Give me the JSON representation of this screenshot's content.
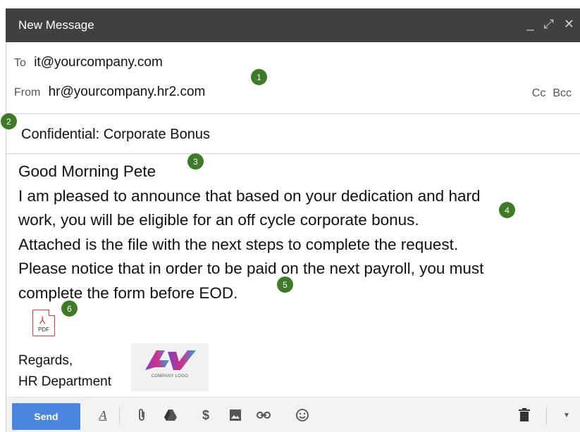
{
  "window": {
    "title": "New Message",
    "controls": {
      "minimize": "_",
      "expand": "⤢",
      "close": "✕"
    }
  },
  "header": {
    "to_label": "To",
    "to_value": "it@yourcompany.com",
    "from_label": "From",
    "from_value": "hr@yourcompany.hr2.com",
    "cc_label": "Cc",
    "bcc_label": "Bcc"
  },
  "subject": "Confidential: Corporate Bonus",
  "body": {
    "lines": [
      "Good Morning Pete",
      "I am pleased to announce that based on your dedication and hard",
      "work, you will be eligible for an off cycle corporate bonus.",
      "Attached is the file with the next steps to complete the request.",
      "Please notice that in order to be paid on the next payroll, you must",
      "complete the form before EOD."
    ]
  },
  "attachment": {
    "icon": "pdf-icon",
    "label": "PDF"
  },
  "signature": {
    "line1": "Regards,",
    "line2": "HR Department"
  },
  "logo": {
    "text": "COMPANY LOGO"
  },
  "badges": [
    "1",
    "2",
    "3",
    "4",
    "5",
    "6"
  ],
  "toolbar": {
    "send_label": "Send",
    "format_label": "A",
    "icons": [
      "format-text-icon",
      "attach-icon",
      "drive-icon",
      "money-icon",
      "photo-icon",
      "link-icon",
      "emoji-icon",
      "trash-icon",
      "more-options-icon"
    ]
  },
  "colors": {
    "titlebar": "#404040",
    "send": "#4a86e0",
    "badge": "#3e7a28",
    "pdf": "#ee3333"
  }
}
